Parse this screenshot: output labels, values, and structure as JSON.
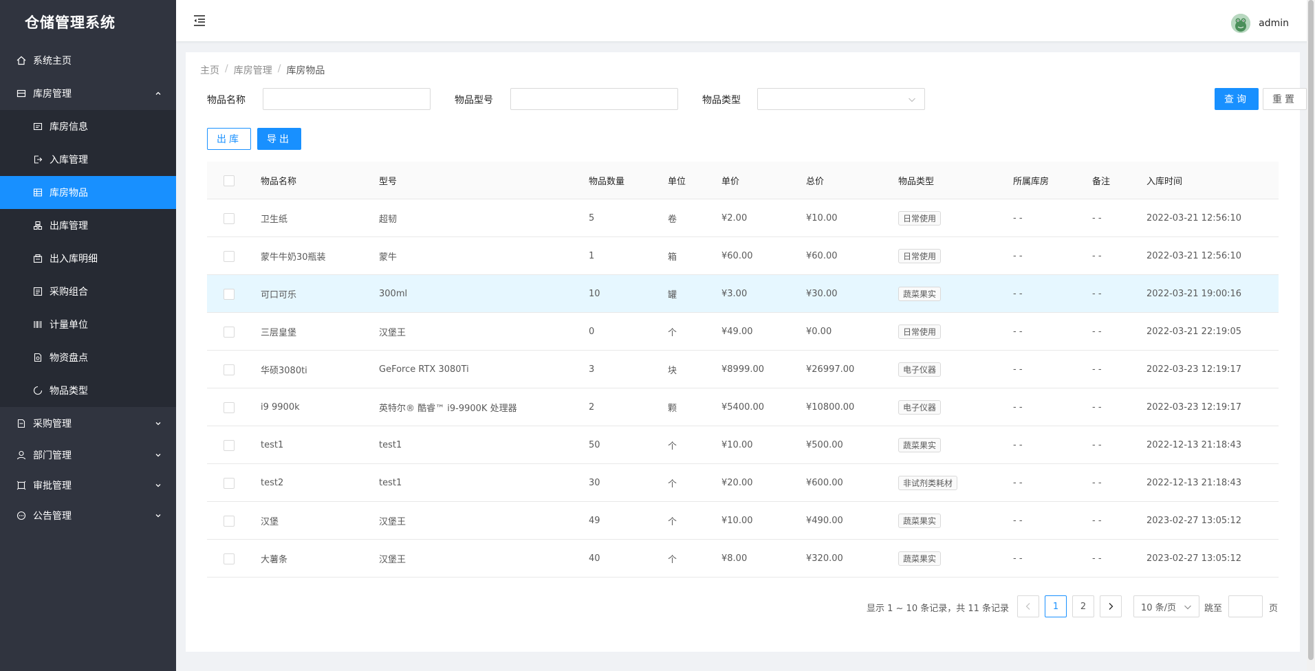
{
  "app": {
    "title": "仓储管理系统"
  },
  "sidebar": {
    "items": [
      {
        "label": "系统主页",
        "icon": "home-icon"
      },
      {
        "label": "库房管理",
        "icon": "storage-icon",
        "expanded": true,
        "children": [
          {
            "label": "库房信息",
            "icon": "info-icon"
          },
          {
            "label": "入库管理",
            "icon": "inbound-icon"
          },
          {
            "label": "库房物品",
            "icon": "table-icon",
            "active": true
          },
          {
            "label": "出库管理",
            "icon": "outbound-icon"
          },
          {
            "label": "出入库明细",
            "icon": "detail-icon"
          },
          {
            "label": "采购组合",
            "icon": "combo-icon"
          },
          {
            "label": "计量单位",
            "icon": "barcode-icon"
          },
          {
            "label": "物资盘点",
            "icon": "inventory-icon"
          },
          {
            "label": "物品类型",
            "icon": "loading-icon"
          }
        ]
      },
      {
        "label": "采购管理",
        "icon": "purchase-icon"
      },
      {
        "label": "部门管理",
        "icon": "user-icon"
      },
      {
        "label": "审批管理",
        "icon": "approve-icon"
      },
      {
        "label": "公告管理",
        "icon": "message-icon"
      }
    ]
  },
  "header": {
    "username": "admin"
  },
  "breadcrumb": [
    "主页",
    "库房管理",
    "库房物品"
  ],
  "search": {
    "name_label": "物品名称",
    "model_label": "物品型号",
    "type_label": "物品类型",
    "name_value": "",
    "model_value": "",
    "type_value": "",
    "query_button": "查询",
    "reset_button": "重置"
  },
  "actions": {
    "outbound_button": "出库",
    "export_button": "导出"
  },
  "table": {
    "columns": [
      "物品名称",
      "型号",
      "物品数量",
      "单位",
      "单价",
      "总价",
      "物品类型",
      "所属库房",
      "备注",
      "入库时间"
    ],
    "rows": [
      {
        "name": "卫生纸",
        "model": "超韧",
        "qty": "5",
        "unit": "卷",
        "price": "¥2.00",
        "total": "¥10.00",
        "type": "日常使用",
        "storehouse": "- -",
        "remark": "- -",
        "time": "2022-03-21 12:56:10"
      },
      {
        "name": "蒙牛牛奶30瓶装",
        "model": "蒙牛",
        "qty": "1",
        "unit": "箱",
        "price": "¥60.00",
        "total": "¥60.00",
        "type": "日常使用",
        "storehouse": "- -",
        "remark": "- -",
        "time": "2022-03-21 12:56:10"
      },
      {
        "name": "可口可乐",
        "model": "300ml",
        "qty": "10",
        "unit": "罐",
        "price": "¥3.00",
        "total": "¥30.00",
        "type": "蔬菜果实",
        "storehouse": "- -",
        "remark": "- -",
        "time": "2022-03-21 19:00:16"
      },
      {
        "name": "三层皇堡",
        "model": "汉堡王",
        "qty": "0",
        "unit": "个",
        "price": "¥49.00",
        "total": "¥0.00",
        "type": "日常使用",
        "storehouse": "- -",
        "remark": "- -",
        "time": "2022-03-21 22:19:05"
      },
      {
        "name": "华硕3080ti",
        "model": "GeForce RTX 3080Ti",
        "qty": "3",
        "unit": "块",
        "price": "¥8999.00",
        "total": "¥26997.00",
        "type": "电子仪器",
        "storehouse": "- -",
        "remark": "- -",
        "time": "2022-03-23 12:19:17"
      },
      {
        "name": "i9 9900k",
        "model": "英特尔® 酷睿™ i9-9900K 处理器",
        "qty": "2",
        "unit": "颗",
        "price": "¥5400.00",
        "total": "¥10800.00",
        "type": "电子仪器",
        "storehouse": "- -",
        "remark": "- -",
        "time": "2022-03-23 12:19:17"
      },
      {
        "name": "test1",
        "model": "test1",
        "qty": "50",
        "unit": "个",
        "price": "¥10.00",
        "total": "¥500.00",
        "type": "蔬菜果实",
        "storehouse": "- -",
        "remark": "- -",
        "time": "2022-12-13 21:18:43"
      },
      {
        "name": "test2",
        "model": "test1",
        "qty": "30",
        "unit": "个",
        "price": "¥20.00",
        "total": "¥600.00",
        "type": "非试剂类耗材",
        "storehouse": "- -",
        "remark": "- -",
        "time": "2022-12-13 21:18:43"
      },
      {
        "name": "汉堡",
        "model": "汉堡王",
        "qty": "49",
        "unit": "个",
        "price": "¥10.00",
        "total": "¥490.00",
        "type": "蔬菜果实",
        "storehouse": "- -",
        "remark": "- -",
        "time": "2023-02-27 13:05:12"
      },
      {
        "name": "大薯条",
        "model": "汉堡王",
        "qty": "40",
        "unit": "个",
        "price": "¥8.00",
        "total": "¥320.00",
        "type": "蔬菜果实",
        "storehouse": "- -",
        "remark": "- -",
        "time": "2023-02-27 13:05:12"
      }
    ]
  },
  "pagination": {
    "total_text": "显示 1 ~ 10 条记录，共 11 条记录",
    "pages": [
      "1",
      "2"
    ],
    "current": "1",
    "page_size": "10 条/页",
    "jump_label": "跳至",
    "jump_suffix": "页"
  },
  "colors": {
    "primary": "#1890ff",
    "sidebar_bg": "#30343f",
    "submenu_bg": "#262a33"
  }
}
